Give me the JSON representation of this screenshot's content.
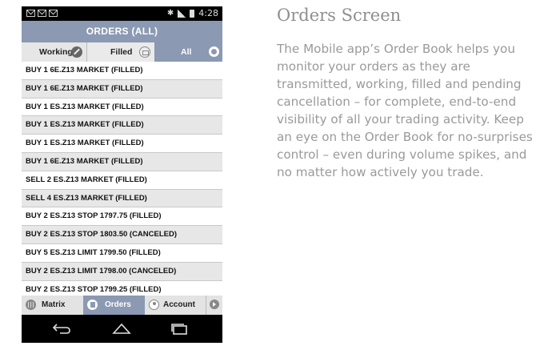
{
  "status_bar": {
    "time": "4:28",
    "icons": [
      "mail-icon",
      "mail-icon",
      "mail-icon",
      "bluetooth-icon",
      "signal-icon",
      "battery-icon"
    ]
  },
  "header": {
    "title": "ORDERS (ALL)"
  },
  "tabs": [
    {
      "label": "Working",
      "icon": "edit-icon",
      "selected": false
    },
    {
      "label": "Filled",
      "icon": "filled-icon",
      "selected": false
    },
    {
      "label": "All",
      "icon": "all-icon",
      "selected": true
    }
  ],
  "orders": [
    "BUY 1 6E.Z13 MARKET (FILLED)",
    "BUY 1 6E.Z13 MARKET (FILLED)",
    "BUY 1 ES.Z13 MARKET (FILLED)",
    "BUY 1 ES.Z13 MARKET (FILLED)",
    "BUY 1 ES.Z13 MARKET (FILLED)",
    "BUY 1 6E.Z13 MARKET (FILLED)",
    "SELL 2 ES.Z13 MARKET (FILLED)",
    "SELL 4 ES.Z13 MARKET (FILLED)",
    "BUY 2 ES.Z13 STOP 1797.75 (FILLED)",
    "BUY 2 ES.Z13 STOP 1803.50 (CANCELED)",
    "BUY 5 ES.Z13 LIMIT 1799.50 (FILLED)",
    "BUY 2 ES.Z13 LIMIT 1798.00 (CANCELED)",
    "BUY 2 ES.Z13 STOP 1799.25 (FILLED)"
  ],
  "bottom_nav": [
    {
      "label": "Matrix",
      "icon": "matrix-icon",
      "selected": false
    },
    {
      "label": "Orders",
      "icon": "orders-icon",
      "selected": true
    },
    {
      "label": "Account",
      "icon": "account-icon",
      "selected": false
    }
  ],
  "side": {
    "title": "Orders Screen",
    "body": "The Mobile app’s Order Book helps you monitor your orders as they are transmitted, working, filled and pending cancellation – for complete, end-to-end visibility of all your trading activity. Keep an eye on the Order Book for no-surprises control – even during volume spikes, and no matter how actively you trade."
  },
  "colors": {
    "accent": "#8b99b2",
    "row_alt": "#e7e7e7",
    "side_text": "#9a9a9a"
  }
}
